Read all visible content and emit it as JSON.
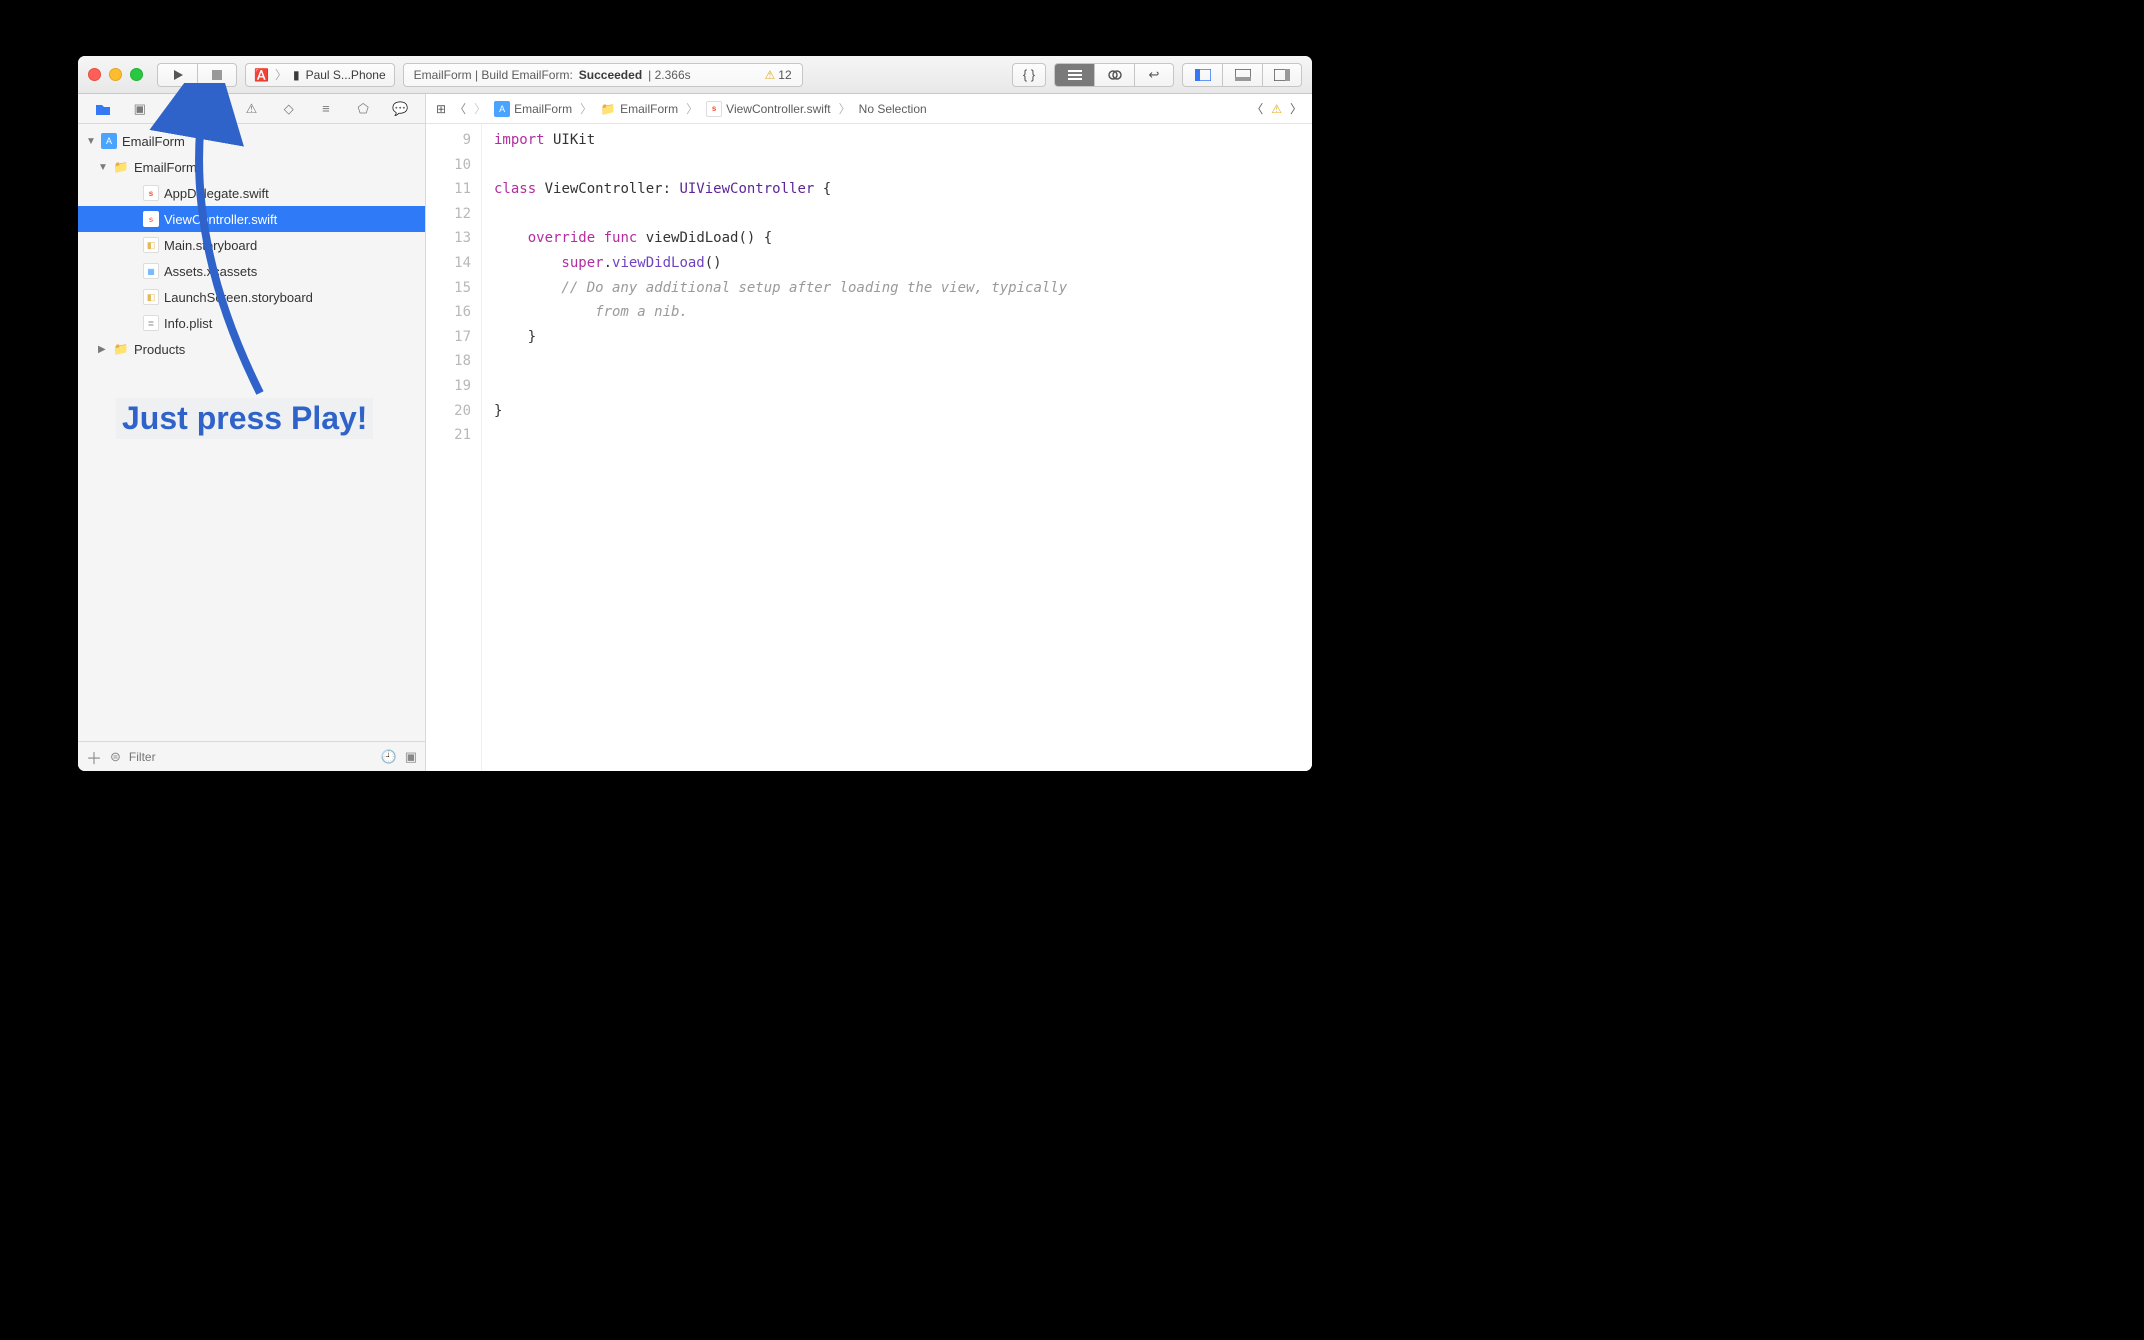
{
  "toolbar": {
    "scheme_text": "Paul S...Phone",
    "status_prefix": "EmailForm | Build EmailForm:",
    "status_result": "Succeeded",
    "status_time": "| 2.366s",
    "warning_count": "12"
  },
  "navigator": {
    "project": "EmailForm",
    "group": "EmailForm",
    "files": {
      "appdelegate": "AppDelegate.swift",
      "viewcontroller": "ViewController.swift",
      "mainsb": "Main.storyboard",
      "assets": "Assets.xcassets",
      "launchsb": "LaunchScreen.storyboard",
      "infoplist": "Info.plist"
    },
    "products": "Products",
    "filter_placeholder": "Filter"
  },
  "jumpbar": {
    "c0": "EmailForm",
    "c1": "EmailForm",
    "c2": "ViewController.swift",
    "c3": "No Selection"
  },
  "code": {
    "lines": [
      "9",
      "10",
      "11",
      "12",
      "13",
      "14",
      "15",
      "",
      "16",
      "17",
      "18",
      "19",
      "20",
      "21"
    ],
    "l9a": "import",
    "l9b": " UIKit",
    "l11a": "class",
    "l11b": " ViewController: ",
    "l11c": "UIViewController",
    "l11d": " {",
    "l13a": "    override",
    "l13b": " func",
    "l13c": " viewDidLoad() {",
    "l14a": "        super",
    "l14b": ".",
    "l14c": "viewDidLoad",
    "l14d": "()",
    "l15": "        // Do any additional setup after loading the view, typically",
    "l15b": "            from a nib.",
    "l16": "    }",
    "l19": "}"
  },
  "annotation": "Just press Play!"
}
